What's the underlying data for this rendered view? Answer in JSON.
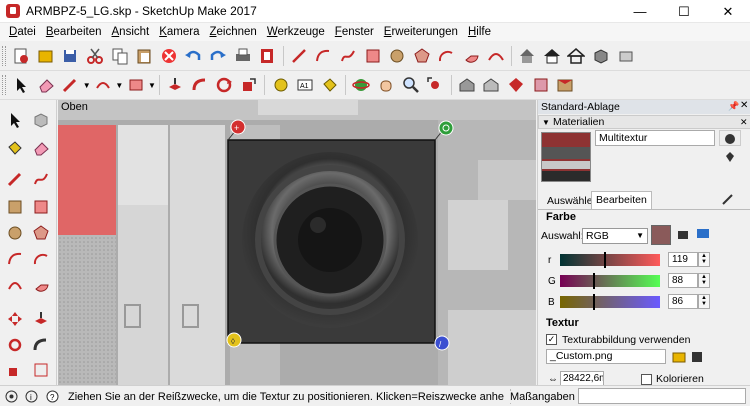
{
  "window": {
    "title": "ARMBPZ-5_LG.skp - SketchUp Make 2017",
    "min_label": "—",
    "max_label": "☐",
    "close_label": "✕"
  },
  "menu": [
    "Datei",
    "Bearbeiten",
    "Ansicht",
    "Kamera",
    "Zeichnen",
    "Werkzeuge",
    "Fenster",
    "Erweiterungen",
    "Hilfe"
  ],
  "viewport": {
    "view_name": "Oben"
  },
  "panel": {
    "title": "Standard-Ablage",
    "section": "Materialien",
    "material_name": "Multitextur",
    "tabs": [
      "Auswählen",
      "Bearbeiten"
    ],
    "active_tab": "Bearbeiten",
    "color": {
      "heading": "Farbe",
      "picker_label": "Auswahl:",
      "picker_value": "RGB",
      "swatch": "#8a5a5a",
      "r": {
        "label": "r",
        "value": "119"
      },
      "g": {
        "label": "G",
        "value": "88"
      },
      "b": {
        "label": "B",
        "value": "86"
      }
    },
    "texture": {
      "heading": "Textur",
      "use_label": "Texturabbildung verwenden",
      "use_checked": true,
      "file": "_Custom.png",
      "width": "28422,6m",
      "colorize_label": "Kolorieren"
    }
  },
  "status": {
    "message": "Ziehen Sie an der Reißzwecke, um die Textur zu positionieren. Klicken=Reiszwecke anhe",
    "measure_label": "Maßangaben"
  },
  "colors": {
    "accent_red": "#c62828",
    "pin_red": "#d32f2f",
    "pin_green": "#2e9e3a",
    "pin_yellow": "#e3c21b",
    "pin_blue": "#3b4fd1"
  }
}
